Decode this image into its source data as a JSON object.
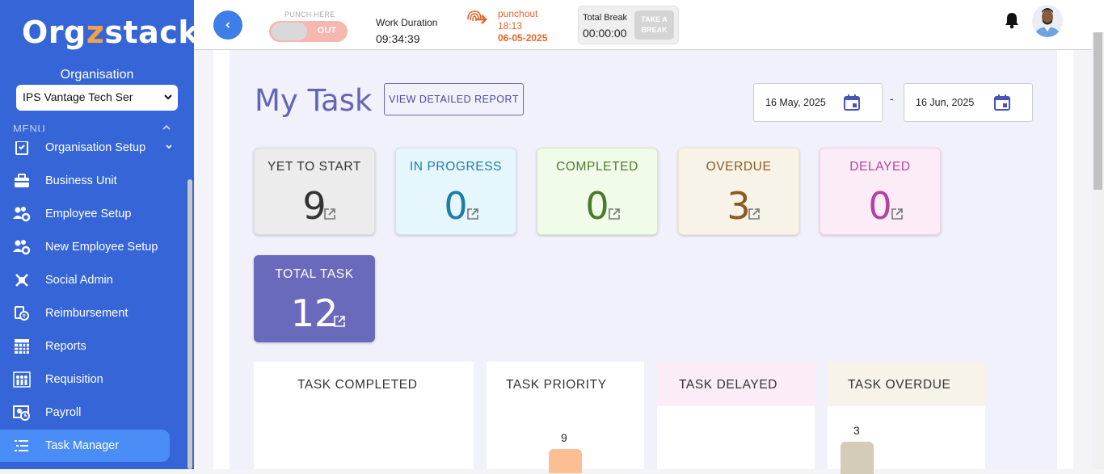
{
  "sidebar": {
    "logo_prefix": "Org",
    "logo_z": "z",
    "logo_suffix": "stack",
    "org_label": "Organisation",
    "org_select_value": "IPS Vantage Tech Ser",
    "menu_label": "MENU",
    "items": [
      {
        "label": "Organisation Setup",
        "icon": "org-setup-icon"
      },
      {
        "label": "Business Unit",
        "icon": "briefcase-icon"
      },
      {
        "label": "Employee Setup",
        "icon": "people-gear-icon"
      },
      {
        "label": "New Employee Setup",
        "icon": "people-gear-icon"
      },
      {
        "label": "Social Admin",
        "icon": "social-icon"
      },
      {
        "label": "Reimbursement",
        "icon": "reimbursement-icon"
      },
      {
        "label": "Reports",
        "icon": "grid-icon"
      },
      {
        "label": "Requisition",
        "icon": "people-chart-icon"
      },
      {
        "label": "Payroll",
        "icon": "payroll-icon"
      },
      {
        "label": "Task Manager",
        "icon": "task-list-icon",
        "active": true
      }
    ]
  },
  "topbar": {
    "punch_label": "PUNCH HERE",
    "punch_out": "OUT",
    "work_duration_label": "Work Duration",
    "work_duration_value": "09:34:39",
    "punchout_label": "punchout",
    "punchout_time": "18:13",
    "punchout_date": "06-05-2025",
    "break_label": "Total Break",
    "break_value": "00:00:00",
    "take_break_line1": "TAKE A",
    "take_break_line2": "BREAK"
  },
  "page": {
    "title": "My Task",
    "report_button": "VIEW DETAILED REPORT",
    "date_from": "16 May, 2025",
    "date_sep": "-",
    "date_to": "16 Jun, 2025"
  },
  "stats": [
    {
      "label": "YET TO START",
      "value": "9",
      "bg": "#ececec",
      "border": "#dcdcdc",
      "color": "#333333",
      "num_color": "#333333"
    },
    {
      "label": "IN PROGRESS",
      "value": "0",
      "bg": "#e6f6fd",
      "border": "#c9e7f4",
      "color": "#1b7fa6",
      "num_color": "#1b7fa6"
    },
    {
      "label": "COMPLETED",
      "value": "0",
      "bg": "#f1fbea",
      "border": "#d3ebc4",
      "color": "#4d7a2a",
      "num_color": "#4d7a2a"
    },
    {
      "label": "OVERDUE",
      "value": "3",
      "bg": "#f8f3e8",
      "border": "#efe6d2",
      "color": "#8a5a1e",
      "num_color": "#8a5a1e"
    },
    {
      "label": "DELAYED",
      "value": "0",
      "bg": "#fcecf8",
      "border": "#f1d3ea",
      "color": "#b044a2",
      "num_color": "#b044a2"
    },
    {
      "label": "TOTAL TASK",
      "value": "12",
      "bg": "#6a6abd",
      "border": "#6a6abd",
      "color": "#ffffff",
      "num_color": "#ffffff"
    }
  ],
  "panels": [
    {
      "title": "TASK COMPLETED",
      "head_bg": "#ffffff"
    },
    {
      "title": "TASK PRIORITY",
      "head_bg": "#ffffff",
      "bar_value": "9",
      "bar_color": "#fcbf94"
    },
    {
      "title": "TASK DELAYED",
      "head_bg": "#fcecf8"
    },
    {
      "title": "TASK OVERDUE",
      "head_bg": "#f8f3e8",
      "bar_value": "3",
      "bar_color": "#d4cbb8"
    }
  ]
}
